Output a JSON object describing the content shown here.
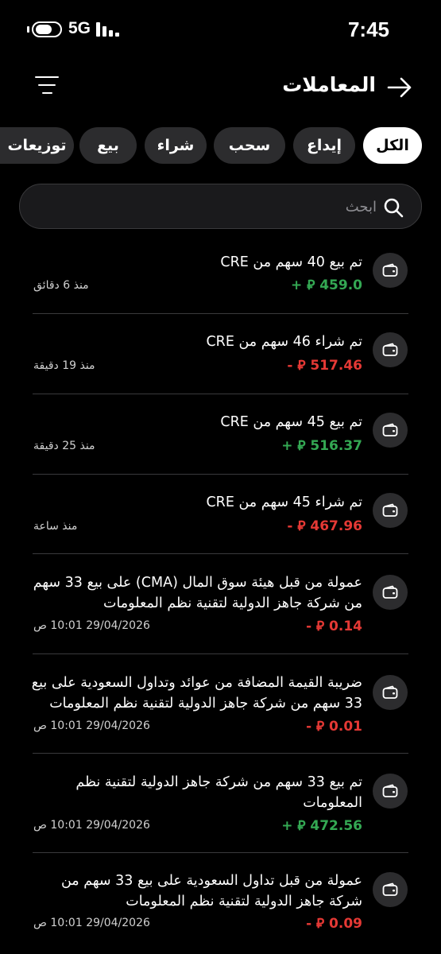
{
  "status_bar": {
    "network": "5G",
    "time": "7:45"
  },
  "header": {
    "title": "المعاملات"
  },
  "filters": {
    "chips": [
      {
        "label": "الكل",
        "active": true
      },
      {
        "label": "إيداع",
        "active": false
      },
      {
        "label": "سحب",
        "active": false
      },
      {
        "label": "شراء",
        "active": false
      },
      {
        "label": "بيع",
        "active": false
      },
      {
        "label": "توزيعات",
        "active": false
      }
    ]
  },
  "search": {
    "placeholder": "ابحث"
  },
  "transactions": [
    {
      "title": "تم بيع 40 سهم من CRE",
      "amount": "+ ⃁ 459.0",
      "sign": "pos",
      "time": "منذ 6 دقائق"
    },
    {
      "title": "تم شراء 46 سهم من CRE",
      "amount": "- ⃁ 517.46",
      "sign": "neg",
      "time": "منذ 19 دقيقة"
    },
    {
      "title": "تم بيع 45 سهم من CRE",
      "amount": "+ ⃁ 516.37",
      "sign": "pos",
      "time": "منذ 25 دقيقة"
    },
    {
      "title": "تم شراء 45 سهم من CRE",
      "amount": "- ⃁ 467.96",
      "sign": "neg",
      "time": "منذ ساعة"
    },
    {
      "title": "عمولة من قبل هيئة سوق المال (CMA) على بيع 33 سهم من شركة جاهز الدولية لتقنية نظم المعلومات",
      "amount": "- ⃁ 0.14",
      "sign": "neg",
      "time": "29/04/2026 10:01 ص"
    },
    {
      "title": "ضريبة القيمة المضافة من عوائد وتداول السعودية على بيع 33 سهم من شركة جاهز الدولية لتقنية نظم المعلومات",
      "amount": "- ⃁ 0.01",
      "sign": "neg",
      "time": "29/04/2026 10:01 ص"
    },
    {
      "title": "تم بيع 33 سهم من شركة جاهز الدولية لتقنية نظم المعلومات",
      "amount": "+ ⃁ 472.56",
      "sign": "pos",
      "time": "29/04/2026 10:01 ص"
    },
    {
      "title": "عمولة من قبل تداول السعودية على بيع 33 سهم من شركة جاهز الدولية لتقنية نظم المعلومات",
      "amount": "- ⃁ 0.09",
      "sign": "neg",
      "time": "29/04/2026 10:01 ص"
    }
  ],
  "icons": {
    "back": "arrow-right-icon",
    "filter": "filter-lines-icon",
    "search": "search-icon",
    "row": "wallet-icon"
  },
  "colors": {
    "positive": "#34a853",
    "negative": "#e53935",
    "chip_bg": "#2c2c2e",
    "chip_active_bg": "#ffffff"
  }
}
